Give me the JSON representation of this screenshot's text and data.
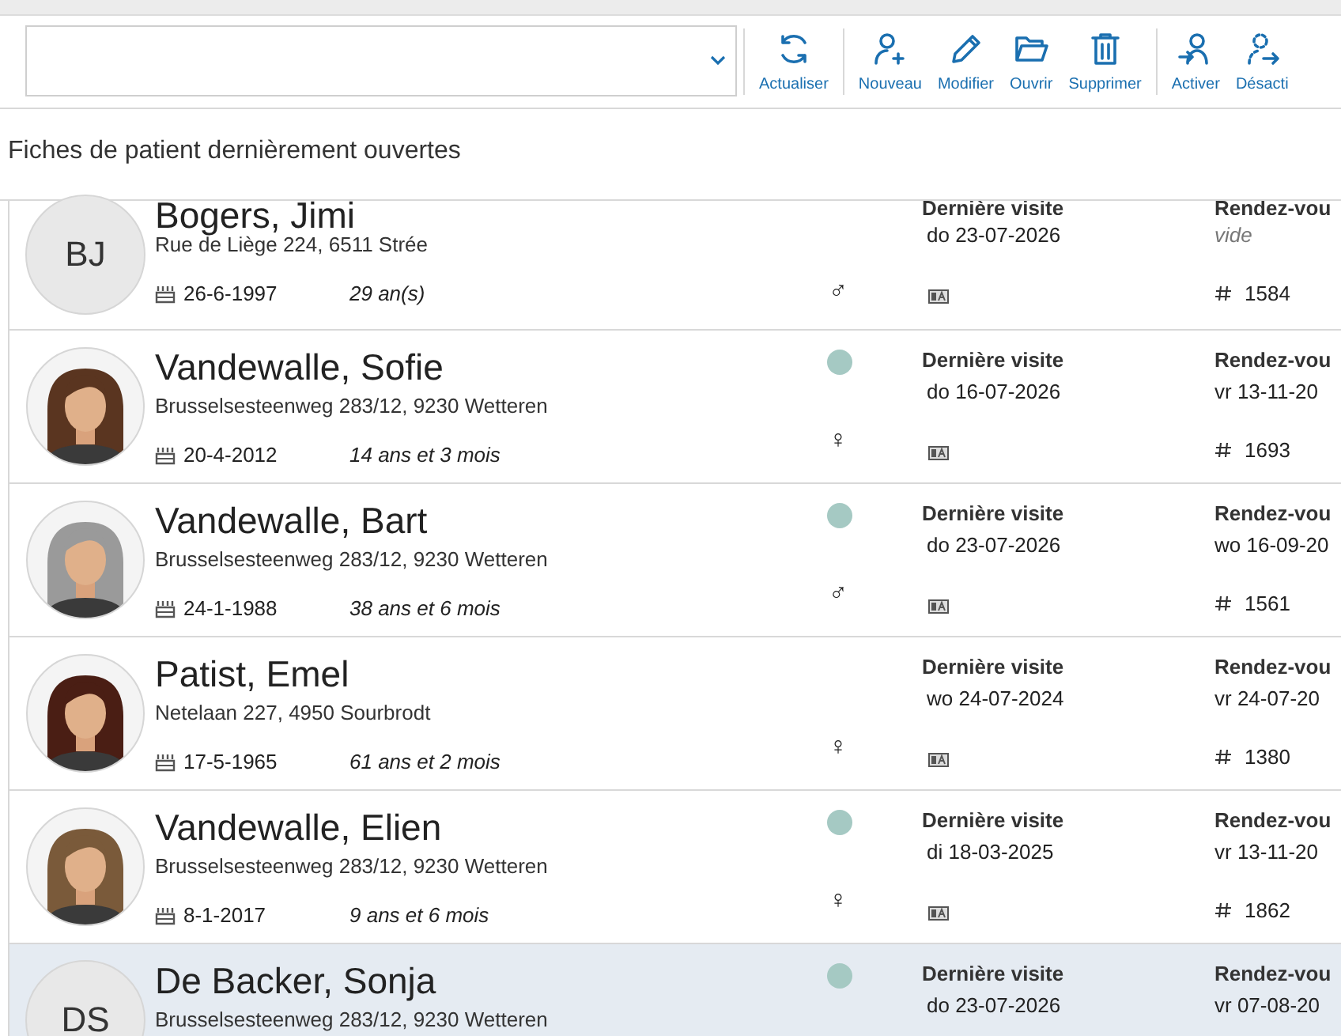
{
  "toolbar": {
    "groups": [
      [
        {
          "label": "Actualiser"
        }
      ],
      [
        {
          "label": "Nouveau"
        },
        {
          "label": "Modifier"
        },
        {
          "label": "Ouvrir"
        },
        {
          "label": "Supprimer"
        }
      ],
      [
        {
          "label": "Activer"
        },
        {
          "label": "Désacti"
        }
      ]
    ]
  },
  "heading": "Fiches de patient dernièrement ouvertes",
  "patients": [
    {
      "avatar": {
        "kind": "initials",
        "text": "BJ"
      },
      "name": "Bogers, Jimi",
      "address": "Rue de Liège 224, 6511 Strée",
      "birth": "26-6-1997",
      "age": "29 an(s)",
      "status_dot": false,
      "gender": "♂",
      "visit_label": "Dernière visite",
      "visit_date": "do 23-07-2026",
      "rdv_label": "Rendez-vou",
      "rdv_value": "vide",
      "rdv_empty": true,
      "number": "1584",
      "selected": false
    },
    {
      "name": "Vandewalle, Sofie",
      "address": "Brusselsesteenweg 283/12, 9230 Wetteren",
      "birth": "20-4-2012",
      "age": "14 ans et 3 mois",
      "status_dot": true,
      "color": "#a5c9c3",
      "gender": "♀",
      "visit_label": "Dernière visite",
      "visit_date": "do 16-07-2026",
      "rdv_label": "Rendez-vou",
      "rdv_value": "vr 13-11-20",
      "rdv_empty": false,
      "number": "1693",
      "selected": false
    },
    {
      "name": "Vandewalle, Bart",
      "address": "Brusselsesteenweg 283/12, 9230 Wetteren",
      "birth": "24-1-1988",
      "age": "38 ans et 6 mois",
      "status_dot": true,
      "color": "#a5c9c3",
      "gender": "♂",
      "visit_label": "Dernière visite",
      "visit_date": "do 23-07-2026",
      "rdv_label": "Rendez-vou",
      "rdv_value": "wo 16-09-20",
      "rdv_empty": false,
      "number": "1561",
      "selected": false
    },
    {
      "name": "Patist, Emel",
      "address": "Netelaan 227, 4950 Sourbrodt",
      "birth": "17-5-1965",
      "age": "61 ans et 2 mois",
      "status_dot": false,
      "gender": "♀",
      "visit_label": "Dernière visite",
      "visit_date": "wo 24-07-2024",
      "rdv_label": "Rendez-vou",
      "rdv_value": "vr 24-07-20",
      "rdv_empty": false,
      "number": "1380",
      "selected": false
    },
    {
      "name": "Vandewalle, Elien",
      "address": "Brusselsesteenweg 283/12, 9230 Wetteren",
      "birth": "8-1-2017",
      "age": "9 ans et 6 mois",
      "status_dot": true,
      "color": "#a5c9c3",
      "gender": "♀",
      "visit_label": "Dernière visite",
      "visit_date": "di 18-03-2025",
      "rdv_label": "Rendez-vou",
      "rdv_value": "vr 13-11-20",
      "rdv_empty": false,
      "number": "1862",
      "selected": false
    },
    {
      "avatar": {
        "kind": "initials",
        "text": "DS"
      },
      "name": "De Backer, Sonja",
      "address": "Brusselsesteenweg 283/12, 9230 Wetteren",
      "status_dot": true,
      "color": "#a5c9c3",
      "visit_label": "Dernière visite",
      "visit_date": "do 23-07-2026",
      "rdv_label": "Rendez-vou",
      "rdv_value": "vr 07-08-20",
      "rdv_empty": false,
      "selected": true
    }
  ]
}
